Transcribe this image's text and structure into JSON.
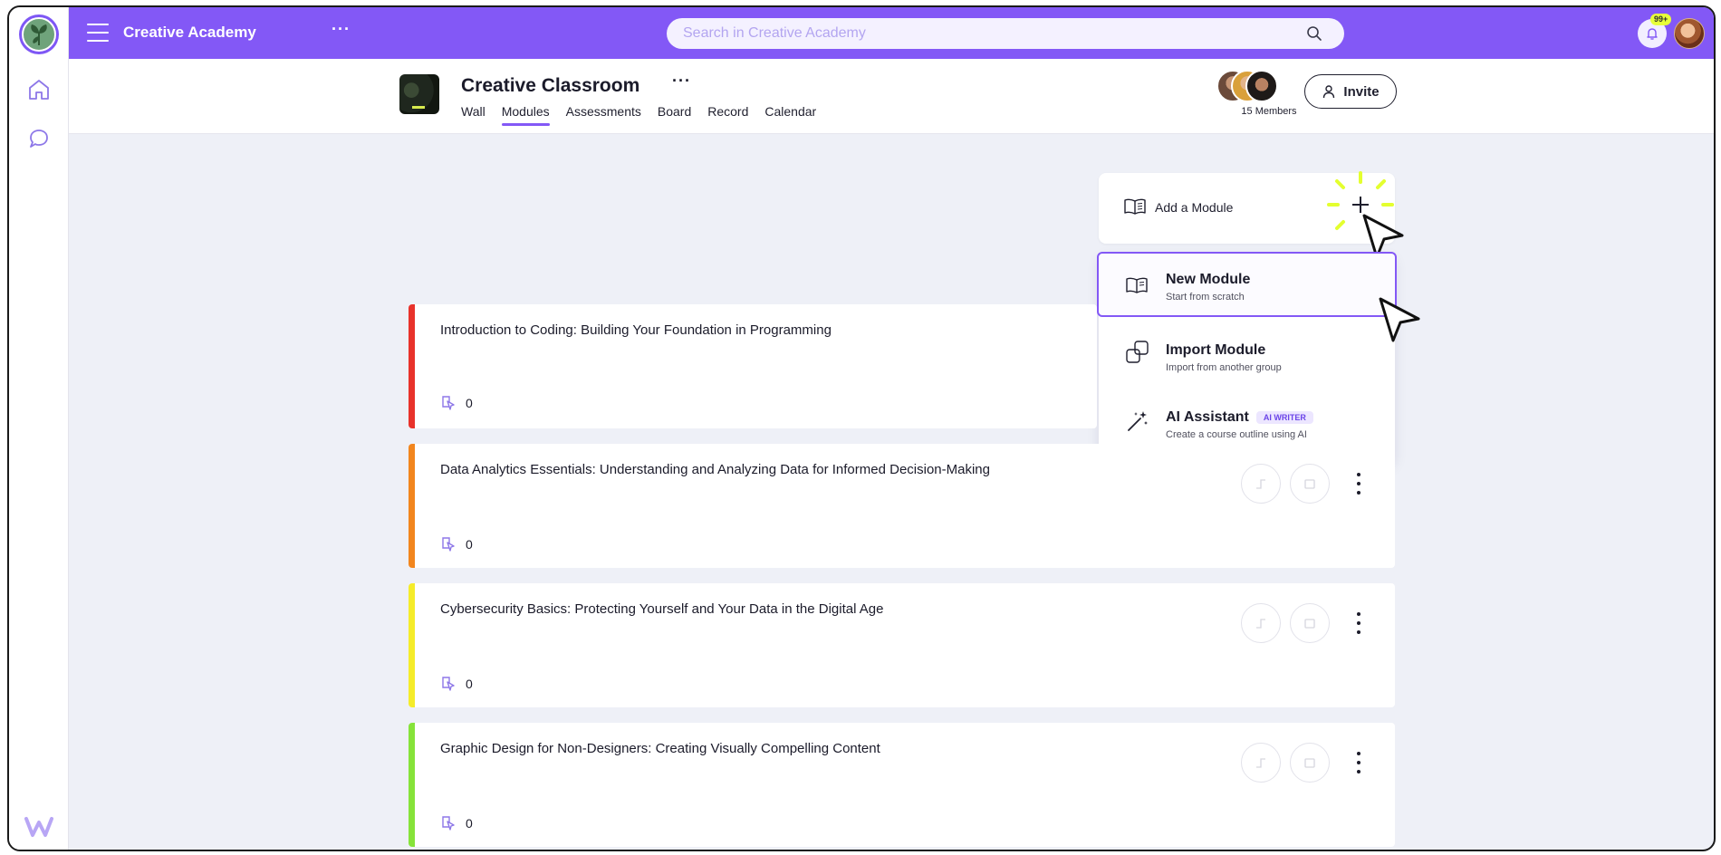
{
  "app": {
    "title": "Creative Academy",
    "more": "···"
  },
  "search": {
    "placeholder": "Search in Creative Academy",
    "value": ""
  },
  "notifications": {
    "badge": "99+"
  },
  "group": {
    "title": "Creative Classroom",
    "more": "···",
    "tabs": [
      {
        "label": "Wall"
      },
      {
        "label": "Modules"
      },
      {
        "label": "Assessments"
      },
      {
        "label": "Board"
      },
      {
        "label": "Record"
      },
      {
        "label": "Calendar"
      }
    ],
    "active_tab": "Modules",
    "members_label": "15 Members",
    "invite_label": "Invite"
  },
  "add_module": {
    "label": "Add a Module"
  },
  "dropdown": {
    "items": [
      {
        "title": "New Module",
        "subtitle": "Start from scratch"
      },
      {
        "title": "Import Module",
        "subtitle": "Import from another group"
      },
      {
        "title": "AI Assistant",
        "badge": "AI WRITER",
        "subtitle": "Create a course outline using AI"
      }
    ]
  },
  "modules": [
    {
      "title": "Introduction to Coding: Building Your Foundation in Programming",
      "count": "0",
      "color": "#e8322b"
    },
    {
      "title": "Data Analytics Essentials: Understanding and Analyzing Data for Informed Decision-Making",
      "count": "0",
      "color": "#f2861e"
    },
    {
      "title": "Cybersecurity Basics: Protecting Yourself and Your Data in the Digital Age",
      "count": "0",
      "color": "#f5ec2a"
    },
    {
      "title": "Graphic Design for Non-Designers: Creating Visually Compelling Content",
      "count": "0",
      "color": "#86e33a"
    }
  ],
  "colors": {
    "brand": "#8358f6",
    "accent_highlight": "#e7ff3a"
  }
}
